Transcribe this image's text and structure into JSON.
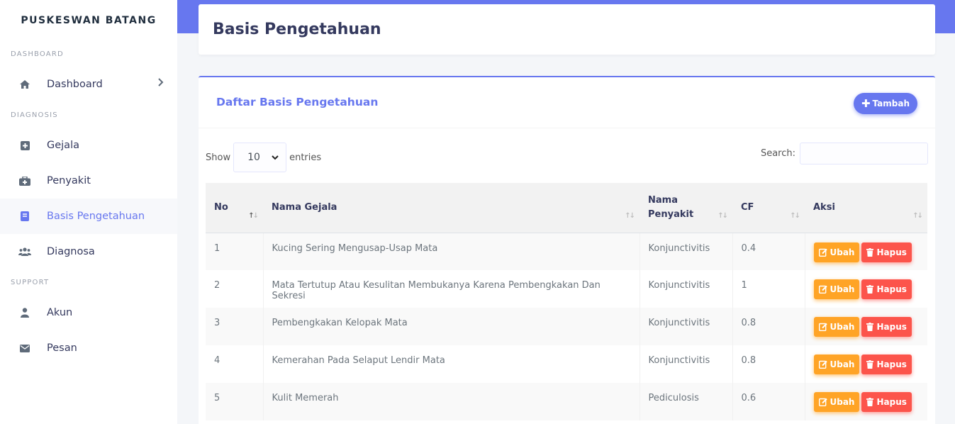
{
  "brand": "PUSKESWAN BATANG",
  "sidebar": {
    "sections": [
      {
        "header": "DASHBOARD",
        "items": [
          {
            "label": "Dashboard",
            "icon": "home-icon"
          }
        ]
      },
      {
        "header": "DIAGNOSIS",
        "items": [
          {
            "label": "Gejala",
            "icon": "plus-square-icon"
          },
          {
            "label": "Penyakit",
            "icon": "medkit-icon"
          },
          {
            "label": "Basis Pengetahuan",
            "icon": "book-icon"
          },
          {
            "label": "Diagnosa",
            "icon": "users-icon"
          }
        ]
      },
      {
        "header": "SUPPORT",
        "items": [
          {
            "label": "Akun",
            "icon": "user-icon"
          },
          {
            "label": "Pesan",
            "icon": "envelope-icon"
          }
        ]
      }
    ],
    "active": "Basis Pengetahuan"
  },
  "page": {
    "title": "Basis Pengetahuan"
  },
  "card": {
    "title": "Daftar Basis Pengetahuan",
    "add_label": "Tambah",
    "show_label": "Show",
    "entries_value": "10",
    "entries_label": "entries",
    "search_label": "Search:",
    "search_value": ""
  },
  "table": {
    "headers": [
      "No",
      "Nama Gejala",
      "Nama Penyakit",
      "CF",
      "Aksi"
    ],
    "rows": [
      {
        "no": "1",
        "gejala": "Kucing Sering Mengusap-Usap Mata",
        "penyakit": "Konjunctivitis",
        "cf": "0.4"
      },
      {
        "no": "2",
        "gejala": "Mata Tertutup Atau Kesulitan Membukanya Karena Pembengkakan Dan Sekresi",
        "penyakit": "Konjunctivitis",
        "cf": "1"
      },
      {
        "no": "3",
        "gejala": "Pembengkakan Kelopak Mata",
        "penyakit": "Konjunctivitis",
        "cf": "0.8"
      },
      {
        "no": "4",
        "gejala": "Kemerahan Pada Selaput Lendir Mata",
        "penyakit": "Konjunctivitis",
        "cf": "0.8"
      },
      {
        "no": "5",
        "gejala": "Kulit Memerah",
        "penyakit": "Pediculosis",
        "cf": "0.6"
      }
    ],
    "edit_label": "Ubah",
    "delete_label": "Hapus"
  },
  "colors": {
    "primary": "#6777ef",
    "warning": "#ffa426",
    "danger": "#fc544b"
  }
}
